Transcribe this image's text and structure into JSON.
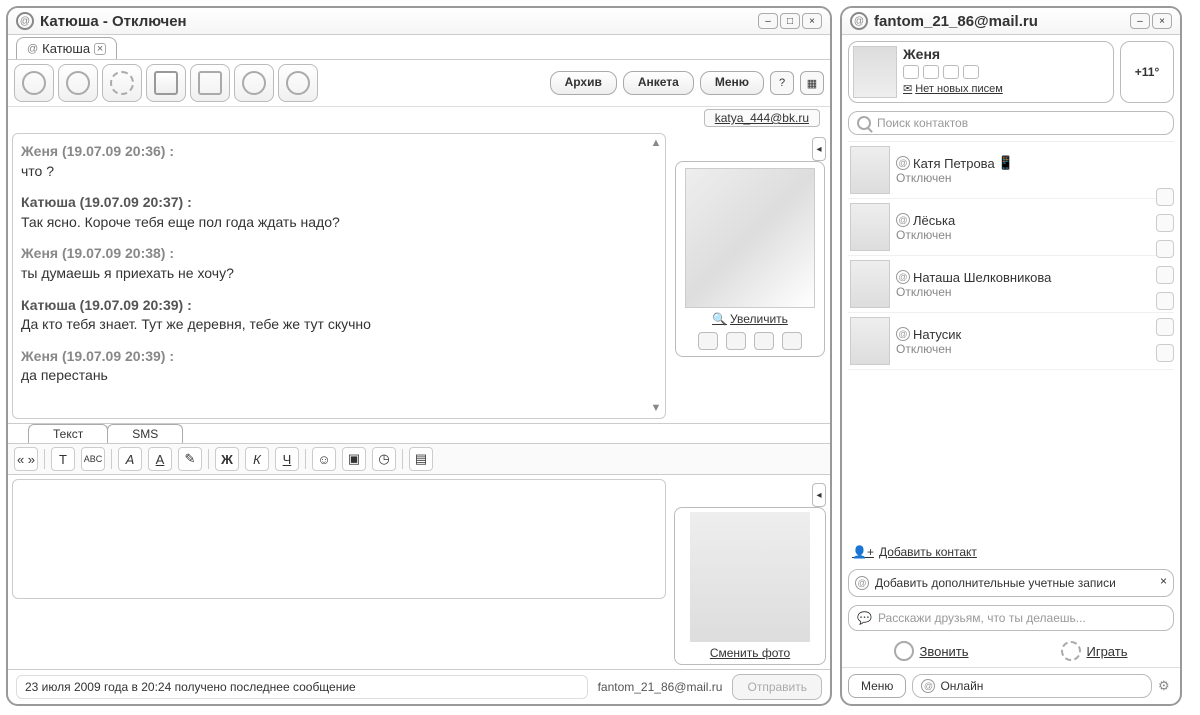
{
  "chat": {
    "title": "Катюша - Отключен",
    "tab": "Катюша",
    "toolbar": {
      "archive": "Архив",
      "profile": "Анкета",
      "menu": "Меню"
    },
    "address": "katya_444@bk.ru",
    "messages": [
      {
        "author": "Женя",
        "ts": "19.07.09 20:36",
        "text": "что ?",
        "dir": "out"
      },
      {
        "author": "Катюша",
        "ts": "19.07.09 20:37",
        "text": "Так ясно. Короче тебя еще пол года ждать надо?",
        "dir": "in"
      },
      {
        "author": "Женя",
        "ts": "19.07.09 20:38",
        "text": "ты думаешь я приехать не хочу?",
        "dir": "out"
      },
      {
        "author": "Катюша",
        "ts": "19.07.09 20:39",
        "text": "Да кто тебя знает. Тут же деревня, тебе же тут скучно",
        "dir": "in"
      },
      {
        "author": "Женя",
        "ts": "19.07.09 20:39",
        "text": "да перестань",
        "dir": "out"
      }
    ],
    "enlarge": "Увеличить",
    "input_tabs": {
      "text": "Текст",
      "sms": "SMS"
    },
    "fmt": {
      "bold": "Ж",
      "italic": "К",
      "under": "Ч",
      "quote": "« »",
      "t": "T",
      "abc": "ABC",
      "a1": "A",
      "a2": "A"
    },
    "change_photo": "Сменить фото",
    "status_line": "23 июля 2009 года в 20:24 получено последнее сообщение",
    "status_email": "fantom_21_86@mail.ru",
    "send": "Отправить"
  },
  "contacts": {
    "title": "fantom_21_86@mail.ru",
    "profile_name": "Женя",
    "no_mail": "Нет новых писем",
    "weather": "+11°",
    "search_placeholder": "Поиск контактов",
    "list": [
      {
        "name": "Катя Петрова",
        "status": "Отключен",
        "mobile": true
      },
      {
        "name": "Лёська",
        "status": "Отключен",
        "mobile": false
      },
      {
        "name": "Наташа Шелковникова",
        "status": "Отключен",
        "mobile": false
      },
      {
        "name": "Натусик",
        "status": "Отключен",
        "mobile": false
      }
    ],
    "add_contact": "Добавить контакт",
    "add_accounts": "Добавить дополнительные учетные записи",
    "status_placeholder": "Расскажи друзьям, что ты делаешь...",
    "call": "Звонить",
    "play": "Играть",
    "menu": "Меню",
    "online": "Онлайн"
  }
}
